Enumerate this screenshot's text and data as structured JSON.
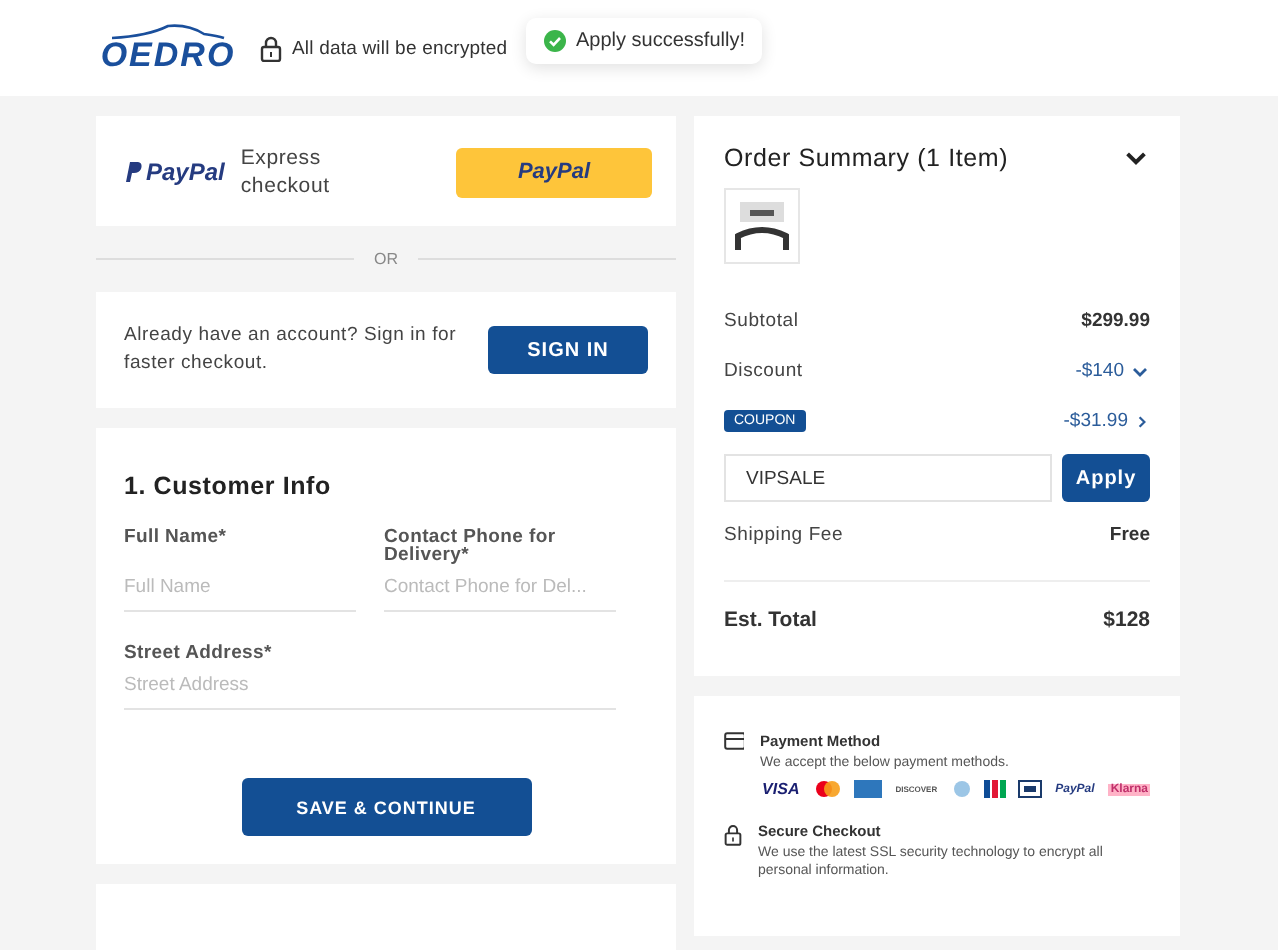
{
  "header": {
    "brand": "OEDRO",
    "security_note": "All data will be encrypted"
  },
  "toast": {
    "message": "Apply successfully!"
  },
  "express": {
    "brand": "PayPal",
    "label": "Express checkout",
    "button": "PayPal"
  },
  "divider": "OR",
  "sign_in": {
    "text": "Already have an account? Sign in for faster checkout.",
    "button": "SIGN IN"
  },
  "customer_info": {
    "title": "1. Customer Info",
    "fields": [
      {
        "label": "Full Name*",
        "placeholder": "Full Name"
      },
      {
        "label": "Contact Phone for Delivery*",
        "placeholder": "Contact Phone for Del..."
      },
      {
        "label": "Street Address*",
        "placeholder": "Street Address"
      }
    ],
    "button": "SAVE & CONTINUE"
  },
  "order_summary": {
    "title": "Order Summary (1 Item)",
    "expanded": true,
    "rows": [
      {
        "kind": "plain",
        "label": "Subtotal",
        "value": "$299.99"
      },
      {
        "kind": "discount",
        "label": "Discount",
        "value": "-$140"
      },
      {
        "kind": "coupon",
        "label": "COUPON",
        "value": "-$31.99"
      }
    ],
    "coupon_field": {
      "value": "VIPSALE",
      "button": "Apply"
    },
    "shipping": {
      "label": "Shipping Fee",
      "value": "Free"
    },
    "total": {
      "label": "Est. Total",
      "value": "$128"
    }
  },
  "trust": [
    {
      "kind": "card",
      "title": "Payment Method",
      "text": "We accept the below payment methods.",
      "logos": [
        {
          "kind": "visa",
          "label": "VISA"
        },
        {
          "kind": "circles"
        },
        {
          "kind": "amex"
        },
        {
          "kind": "discover",
          "label": "DISCOVER"
        },
        {
          "kind": "diners"
        },
        {
          "kind": "jcb"
        },
        {
          "kind": "generic"
        },
        {
          "kind": "paypal",
          "label": "PayPal"
        },
        {
          "kind": "klarna",
          "label": "Klarna"
        }
      ]
    },
    {
      "kind": "lock",
      "title": "Secure Checkout",
      "text": "We use the latest SSL security technology to encrypt all personal information."
    }
  ]
}
